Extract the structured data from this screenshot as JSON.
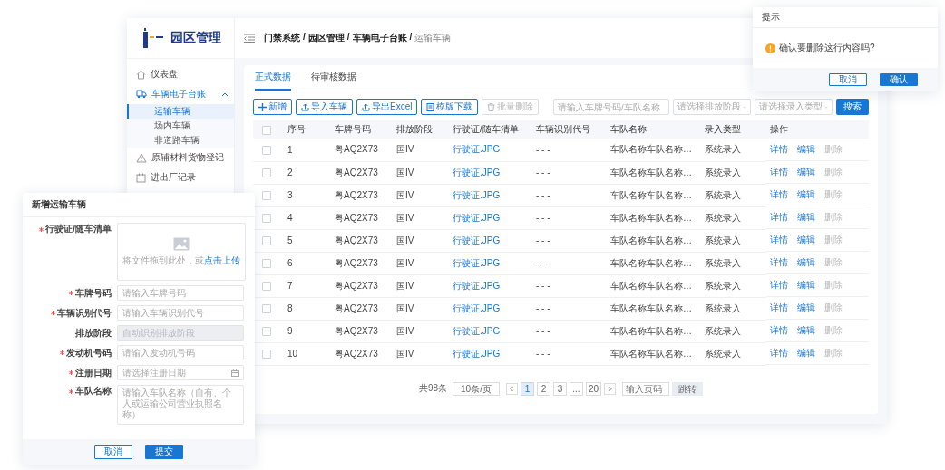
{
  "sidebar": {
    "logo_text": "园区管理",
    "items": [
      {
        "kind": "link",
        "label": "仪表盘",
        "selected": false
      },
      {
        "kind": "group",
        "label": "车辆电子台账",
        "selected": true,
        "expanded": true,
        "children": [
          {
            "label": "运输车辆",
            "selected": true
          },
          {
            "label": "场内车辆",
            "selected": false
          },
          {
            "label": "非道路车辆",
            "selected": false
          }
        ]
      },
      {
        "kind": "link",
        "label": "原辅材料货物登记",
        "selected": false
      },
      {
        "kind": "link",
        "label": "进出厂记录",
        "selected": false
      }
    ]
  },
  "breadcrumb": {
    "items": [
      {
        "label": "门禁系统",
        "current": false
      },
      {
        "label": "园区管理",
        "current": false
      },
      {
        "label": "车辆电子台账",
        "current": false
      },
      {
        "label": "运输车辆",
        "current": true
      }
    ],
    "separators": [
      "/",
      "/",
      "/"
    ]
  },
  "tabs": [
    {
      "label": "正式数据",
      "selected": true
    },
    {
      "label": "待审核数据",
      "selected": false
    }
  ],
  "toolbar": {
    "buttons": [
      {
        "label": "新增",
        "disabled": false
      },
      {
        "label": "导入车辆",
        "disabled": false
      },
      {
        "label": "导出Excel",
        "disabled": false
      },
      {
        "label": "模版下载",
        "disabled": false
      },
      {
        "label": "批量删除",
        "disabled": true
      }
    ],
    "keyword": {
      "placeholder": "请输入车牌号码/车队名称"
    },
    "emission": {
      "placeholder": "请选择排放阶段"
    },
    "entry_type": {
      "placeholder": "请选择录入类型"
    },
    "search_button": "搜索"
  },
  "table": {
    "all_checked": false,
    "columns": [
      "序号",
      "车牌号码",
      "排放阶段",
      "行驶证/随车清单",
      "车辆识别代号",
      "车队名称",
      "录入类型",
      "操作"
    ],
    "rows": [
      {
        "checked": false,
        "cells": [
          "1",
          "粤AQ2X73",
          "国IV",
          "行驶证.JPG",
          "- - -",
          "车队名称车队名称…",
          "系统录入"
        ],
        "actions": [
          {
            "label": "详情",
            "disabled": false
          },
          {
            "label": "编辑",
            "disabled": false
          },
          {
            "label": "删除",
            "disabled": true
          }
        ]
      },
      {
        "checked": false,
        "cells": [
          "2",
          "粤AQ2X73",
          "国IV",
          "行驶证.JPG",
          "- - -",
          "车队名称车队名称…",
          "系统录入"
        ],
        "actions": [
          {
            "label": "详情",
            "disabled": false
          },
          {
            "label": "编辑",
            "disabled": false
          },
          {
            "label": "删除",
            "disabled": true
          }
        ]
      },
      {
        "checked": false,
        "cells": [
          "3",
          "粤AQ2X73",
          "国IV",
          "行驶证.JPG",
          "- - -",
          "车队名称车队名称…",
          "系统录入"
        ],
        "actions": [
          {
            "label": "详情",
            "disabled": false
          },
          {
            "label": "编辑",
            "disabled": false
          },
          {
            "label": "删除",
            "disabled": true
          }
        ]
      },
      {
        "checked": false,
        "cells": [
          "4",
          "粤AQ2X73",
          "国IV",
          "行驶证.JPG",
          "- - -",
          "车队名称车队名称…",
          "系统录入"
        ],
        "actions": [
          {
            "label": "详情",
            "disabled": false
          },
          {
            "label": "编辑",
            "disabled": false
          },
          {
            "label": "删除",
            "disabled": true
          }
        ]
      },
      {
        "checked": false,
        "cells": [
          "5",
          "粤AQ2X73",
          "国IV",
          "行驶证.JPG",
          "- - -",
          "车队名称车队名称…",
          "系统录入"
        ],
        "actions": [
          {
            "label": "详情",
            "disabled": false
          },
          {
            "label": "编辑",
            "disabled": false
          },
          {
            "label": "删除",
            "disabled": true
          }
        ]
      },
      {
        "checked": false,
        "cells": [
          "6",
          "粤AQ2X73",
          "国IV",
          "行驶证.JPG",
          "- - -",
          "车队名称车队名称…",
          "系统录入"
        ],
        "actions": [
          {
            "label": "详情",
            "disabled": false
          },
          {
            "label": "编辑",
            "disabled": false
          },
          {
            "label": "删除",
            "disabled": true
          }
        ]
      },
      {
        "checked": false,
        "cells": [
          "7",
          "粤AQ2X73",
          "国IV",
          "行驶证.JPG",
          "- - -",
          "车队名称车队名称…",
          "系统录入"
        ],
        "actions": [
          {
            "label": "详情",
            "disabled": false
          },
          {
            "label": "编辑",
            "disabled": false
          },
          {
            "label": "删除",
            "disabled": true
          }
        ]
      },
      {
        "checked": false,
        "cells": [
          "8",
          "粤AQ2X73",
          "国IV",
          "行驶证.JPG",
          "- - -",
          "车队名称车队名称…",
          "系统录入"
        ],
        "actions": [
          {
            "label": "详情",
            "disabled": false
          },
          {
            "label": "编辑",
            "disabled": false
          },
          {
            "label": "删除",
            "disabled": true
          }
        ]
      },
      {
        "checked": false,
        "cells": [
          "9",
          "粤AQ2X73",
          "国IV",
          "行驶证.JPG",
          "- - -",
          "车队名称车队名称…",
          "系统录入"
        ],
        "actions": [
          {
            "label": "详情",
            "disabled": false
          },
          {
            "label": "编辑",
            "disabled": false
          },
          {
            "label": "删除",
            "disabled": true
          }
        ]
      },
      {
        "checked": false,
        "cells": [
          "10",
          "粤AQ2X73",
          "国IV",
          "行驶证.JPG",
          "- - -",
          "车队名称车队名称…",
          "系统录入"
        ],
        "actions": [
          {
            "label": "详情",
            "disabled": false
          },
          {
            "label": "编辑",
            "disabled": false
          },
          {
            "label": "删除",
            "disabled": true
          }
        ]
      }
    ]
  },
  "pagination": {
    "total": "共98条",
    "page_size": "10条/页",
    "pages": [
      {
        "label": "1",
        "selected": true
      },
      {
        "label": "2",
        "selected": false
      },
      {
        "label": "3",
        "selected": false
      },
      {
        "label": "...",
        "selected": false
      },
      {
        "label": "20",
        "selected": false
      }
    ],
    "jump_placeholder": "输入页码",
    "jump_button": "跳转"
  },
  "confirm_dialog": {
    "title": "提示",
    "message": "确认要删除这行内容吗?",
    "buttons": [
      {
        "label": "取消",
        "kind": "default"
      },
      {
        "label": "确认",
        "kind": "primary"
      }
    ]
  },
  "form_dialog": {
    "title": "新增运输车辆",
    "fields": [
      {
        "kind": "upload",
        "label": "行驶证/随车清单",
        "required": true,
        "hint": "将文件拖到此处，或",
        "link": "点击上传"
      },
      {
        "kind": "input",
        "label": "车牌号码",
        "required": true,
        "placeholder": "请输入车牌号码",
        "disabled": false
      },
      {
        "kind": "input",
        "label": "车辆识别代号",
        "required": true,
        "placeholder": "请输入车辆识别代号",
        "disabled": false
      },
      {
        "kind": "input",
        "label": "排放阶段",
        "required": false,
        "placeholder": "自动识别排放阶段",
        "disabled": true
      },
      {
        "kind": "input",
        "label": "发动机号码",
        "required": true,
        "placeholder": "请输入发动机号码",
        "disabled": false
      },
      {
        "kind": "date",
        "label": "注册日期",
        "required": true,
        "placeholder": "请选择注册日期"
      },
      {
        "kind": "textarea",
        "label": "车队名称",
        "required": true,
        "placeholder": "请输入车队名称（自有、个人或运输公司营业执照名称）"
      }
    ],
    "buttons": [
      {
        "label": "取消",
        "kind": "default"
      },
      {
        "label": "提交",
        "kind": "primary"
      }
    ]
  }
}
